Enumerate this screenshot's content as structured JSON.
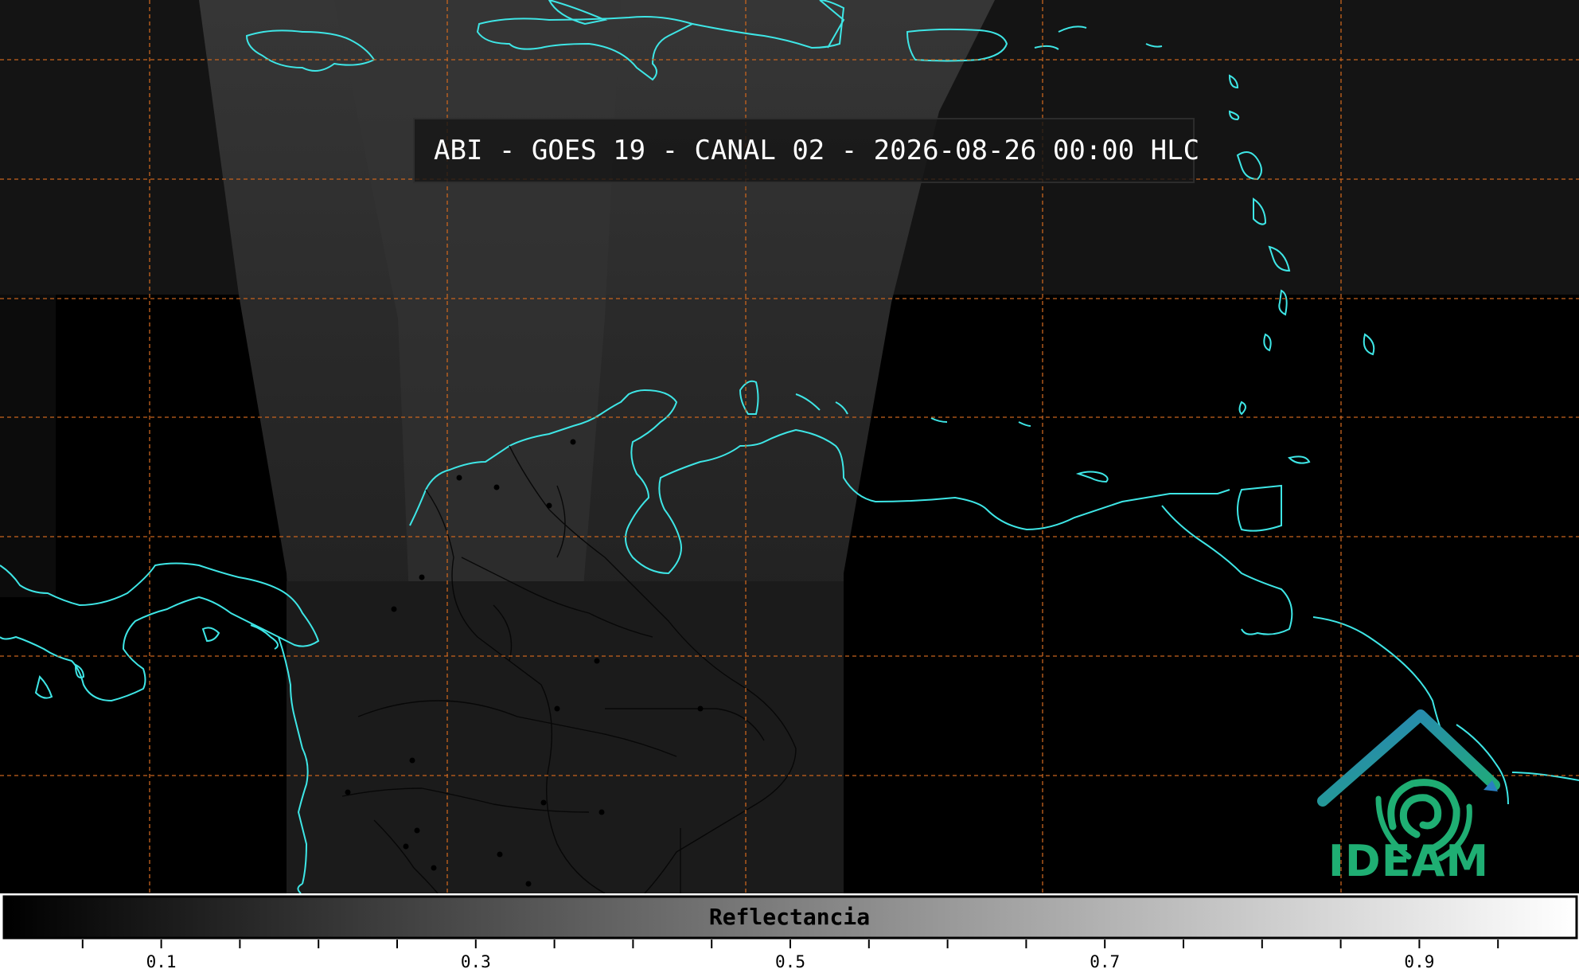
{
  "title": "ABI - GOES 19 - CANAL 02 - 2026-08-26 00:00 HLC",
  "logo": {
    "text": "IDEAM",
    "icon": "ideam-logo-icon",
    "color": "#1fae73"
  },
  "colorbar": {
    "label": "Reflectancia",
    "min": 0.0,
    "max": 1.0,
    "ticks": [
      {
        "label": "0.1",
        "value": 0.1
      },
      {
        "label": "0.3",
        "value": 0.3
      },
      {
        "label": "0.5",
        "value": 0.5
      },
      {
        "label": "0.7",
        "value": 0.7
      },
      {
        "label": "0.9",
        "value": 0.9
      }
    ],
    "minor_step": 0.05
  },
  "colors": {
    "coastline": "#3ee6e6",
    "gridline": "#c8641e",
    "background": "#000000"
  }
}
